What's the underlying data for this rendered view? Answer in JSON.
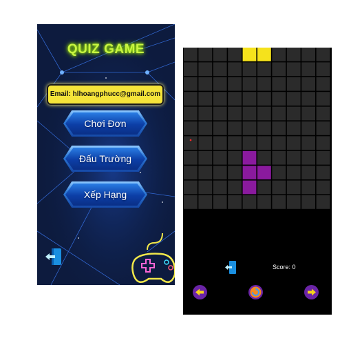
{
  "quiz_screen": {
    "title": "QUIZ GAME",
    "email": "Email: hlhoangphucc@gmail.com",
    "buttons": [
      "Chơi Đơn",
      "Đấu Trường",
      "Xếp Hạng"
    ],
    "colors": {
      "background": "#0d1b3e",
      "title": "#c8f542",
      "email_box": "#f5e43a",
      "button": "#1f5fcf"
    }
  },
  "tetris_screen": {
    "score_text": "Score: 0",
    "grid": {
      "columns": 10,
      "rows": 11
    },
    "active_piece": {
      "color": "#f5e21c",
      "cells": [
        [
          4,
          0
        ],
        [
          5,
          0
        ]
      ]
    },
    "placed_piece": {
      "color": "#8a1a9e",
      "cells": [
        [
          4,
          7
        ],
        [
          4,
          8
        ],
        [
          5,
          8
        ],
        [
          4,
          9
        ]
      ]
    },
    "controls": [
      "left-arrow-icon",
      "rotate-icon",
      "right-arrow-icon"
    ],
    "colors": {
      "cell": "#2b2b2b",
      "background": "#000000",
      "control": "#6a24a6"
    }
  }
}
